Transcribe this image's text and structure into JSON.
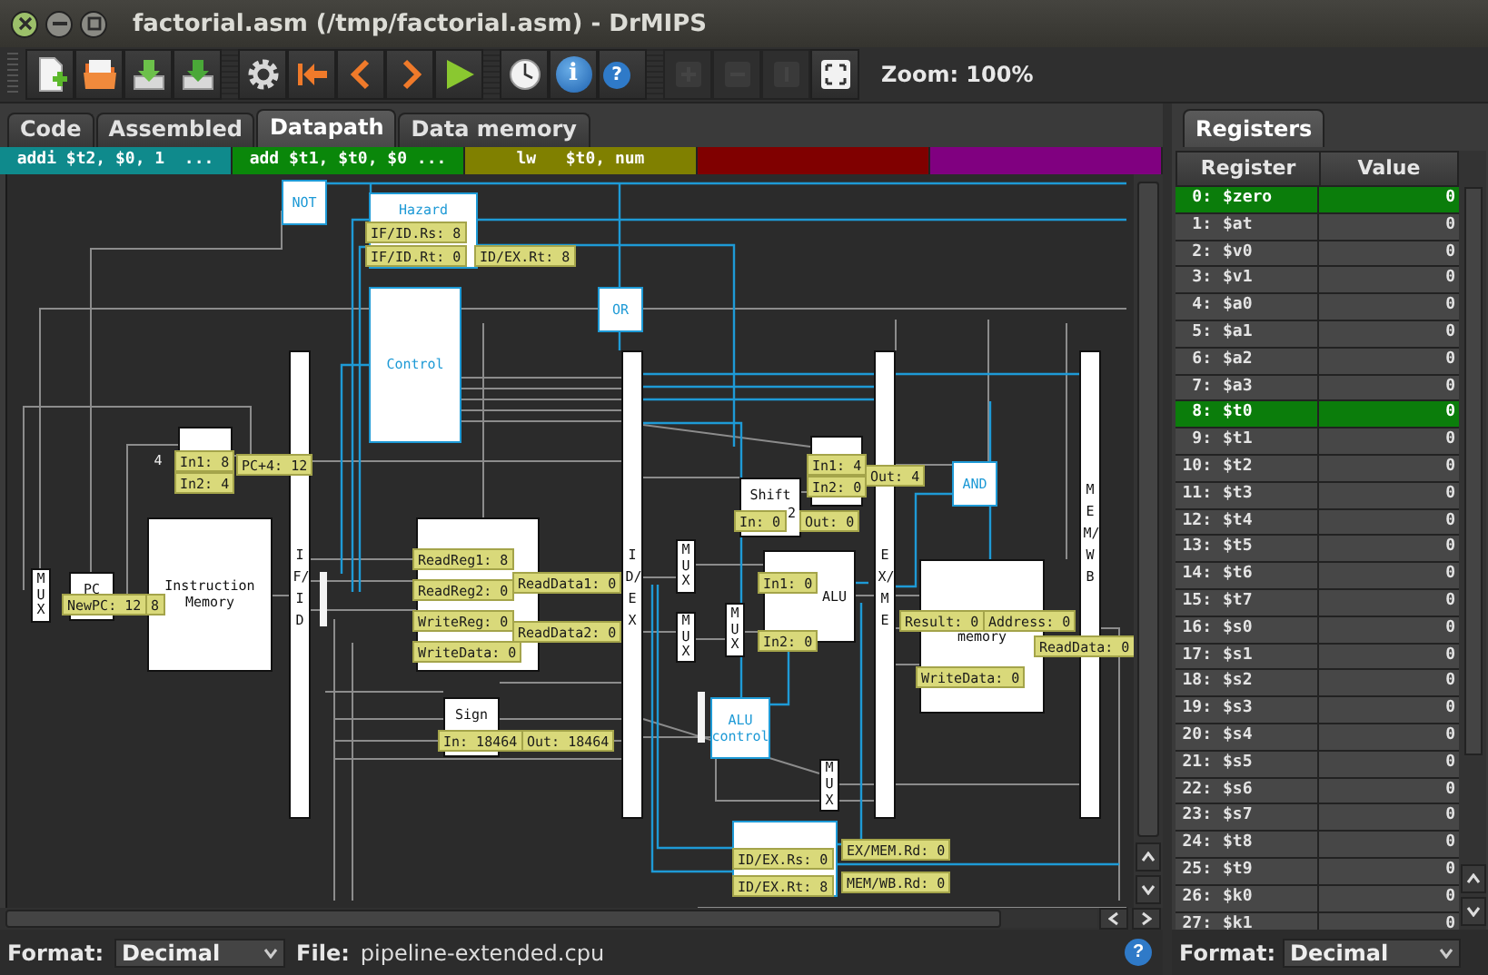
{
  "window": {
    "title": "factorial.asm (/tmp/factorial.asm) - DrMIPS"
  },
  "toolbar": [
    {
      "kind": "new",
      "disabled": false
    },
    {
      "kind": "open",
      "disabled": false
    },
    {
      "kind": "save",
      "disabled": false
    },
    {
      "kind": "save_as",
      "disabled": false
    },
    {
      "kind": "settings",
      "disabled": false
    },
    {
      "kind": "restart",
      "disabled": false
    },
    {
      "kind": "back",
      "disabled": false
    },
    {
      "kind": "forward",
      "disabled": false
    },
    {
      "kind": "run",
      "disabled": false
    },
    {
      "kind": "clock",
      "disabled": false
    },
    {
      "kind": "info",
      "glyph": "i",
      "disabled": false
    },
    {
      "kind": "help",
      "glyph": "?",
      "disabled": false
    },
    {
      "kind": "zoom_in",
      "disabled": true
    },
    {
      "kind": "zoom_out",
      "disabled": true
    },
    {
      "kind": "zoom_normal",
      "disabled": true
    },
    {
      "kind": "zoom_fit",
      "disabled": false
    }
  ],
  "zoom_label": "Zoom: 100%",
  "tabs": [
    {
      "label": "Code",
      "selected": false
    },
    {
      "label": "Assembled",
      "selected": false
    },
    {
      "label": "Datapath",
      "selected": true
    },
    {
      "label": "Data memory",
      "selected": false
    }
  ],
  "pipeline_stages": [
    {
      "instruction": "addi $t2, $0, 1  ...",
      "color": "#0f8a8c"
    },
    {
      "instruction": "add $t1, $t0, $0 ...",
      "color": "#0a870a"
    },
    {
      "instruction": "lw   $t0, num",
      "color": "#808000"
    },
    {
      "color": "#800000"
    },
    {
      "color": "#800080"
    }
  ],
  "datapath": {
    "components": [
      {
        "kind": "unit",
        "label": "NOT"
      },
      {
        "kind": "unit",
        "label": "Hazard"
      },
      {
        "kind": "unit",
        "label": "Control"
      },
      {
        "kind": "unit",
        "label": "OR"
      },
      {
        "kind": "unit",
        "label": "AND"
      },
      {
        "kind": "unit",
        "label": "ALU control"
      },
      {
        "kind": "unit"
      },
      {
        "kind": "block"
      },
      {
        "kind": "block",
        "label": "PC"
      },
      {
        "kind": "block",
        "label": "Instruction Memory"
      },
      {
        "kind": "block"
      },
      {
        "kind": "block",
        "label": "Sign"
      },
      {
        "kind": "block",
        "label": "Shift",
        "sublabel": "2"
      },
      {
        "kind": "block"
      },
      {
        "kind": "block",
        "label": "ALU"
      },
      {
        "kind": "block",
        "label": "memory"
      },
      {
        "kind": "pipeline_register",
        "label": "IF/ID"
      },
      {
        "kind": "pipeline_register",
        "label": "ID/EX"
      },
      {
        "kind": "pipeline_register",
        "label": "EX/ME"
      },
      {
        "kind": "pipeline_register",
        "label": "MEM/WB"
      },
      {
        "kind": "mux",
        "label": "MUX"
      },
      {
        "kind": "mux",
        "label": "MUX"
      },
      {
        "kind": "mux",
        "label": "MUX"
      },
      {
        "kind": "mux",
        "label": "MUX"
      },
      {
        "kind": "mux",
        "label": "MUX"
      },
      {
        "kind": "constant",
        "label": "4"
      }
    ],
    "probes": [
      "IF/ID.Rs: 8",
      "IF/ID.Rt: 0",
      "ID/EX.Rt: 8",
      "In1: 8",
      "In2: 4",
      "PC+4: 12",
      "NewPC: 12",
      "8",
      "ReadReg1: 8",
      "ReadReg2: 0",
      "WriteReg: 0",
      "WriteData: 0",
      "ReadData1: 0",
      "ReadData2: 0",
      "In1: 4",
      "In2: 0",
      "Out: 4",
      "In: 0",
      "Out: 0",
      "In1: 0",
      "In2: 0",
      "Result: 0",
      "Address: 0",
      "WriteData: 0",
      "ReadData: 0",
      "In: 18464",
      "Out: 18464",
      "ID/EX.Rs: 0",
      "ID/EX.Rt: 8",
      "EX/MEM.Rd: 0",
      "MEM/WB.Rd: 0"
    ]
  },
  "status_bar": {
    "format_label": "Format:",
    "format_value": "Decimal",
    "file_label": "File:",
    "file_value": "pipeline-extended.cpu",
    "help_glyph": "?"
  },
  "registers_panel": {
    "tab": "Registers",
    "columns": [
      "Register",
      "Value"
    ],
    "rows": [
      {
        "number": "0:",
        "name": "$zero",
        "value": "0",
        "highlighted": true
      },
      {
        "number": "1:",
        "name": "$at",
        "value": "0",
        "highlighted": false
      },
      {
        "number": "2:",
        "name": "$v0",
        "value": "0",
        "highlighted": false
      },
      {
        "number": "3:",
        "name": "$v1",
        "value": "0",
        "highlighted": false
      },
      {
        "number": "4:",
        "name": "$a0",
        "value": "0",
        "highlighted": false
      },
      {
        "number": "5:",
        "name": "$a1",
        "value": "0",
        "highlighted": false
      },
      {
        "number": "6:",
        "name": "$a2",
        "value": "0",
        "highlighted": false
      },
      {
        "number": "7:",
        "name": "$a3",
        "value": "0",
        "highlighted": false
      },
      {
        "number": "8:",
        "name": "$t0",
        "value": "0",
        "highlighted": true
      },
      {
        "number": "9:",
        "name": "$t1",
        "value": "0",
        "highlighted": false
      },
      {
        "number": "10:",
        "name": "$t2",
        "value": "0",
        "highlighted": false
      },
      {
        "number": "11:",
        "name": "$t3",
        "value": "0",
        "highlighted": false
      },
      {
        "number": "12:",
        "name": "$t4",
        "value": "0",
        "highlighted": false
      },
      {
        "number": "13:",
        "name": "$t5",
        "value": "0",
        "highlighted": false
      },
      {
        "number": "14:",
        "name": "$t6",
        "value": "0",
        "highlighted": false
      },
      {
        "number": "15:",
        "name": "$t7",
        "value": "0",
        "highlighted": false
      },
      {
        "number": "16:",
        "name": "$s0",
        "value": "0",
        "highlighted": false
      },
      {
        "number": "17:",
        "name": "$s1",
        "value": "0",
        "highlighted": false
      },
      {
        "number": "18:",
        "name": "$s2",
        "value": "0",
        "highlighted": false
      },
      {
        "number": "19:",
        "name": "$s3",
        "value": "0",
        "highlighted": false
      },
      {
        "number": "20:",
        "name": "$s4",
        "value": "0",
        "highlighted": false
      },
      {
        "number": "21:",
        "name": "$s5",
        "value": "0",
        "highlighted": false
      },
      {
        "number": "22:",
        "name": "$s6",
        "value": "0",
        "highlighted": false
      },
      {
        "number": "23:",
        "name": "$s7",
        "value": "0",
        "highlighted": false
      },
      {
        "number": "24:",
        "name": "$t8",
        "value": "0",
        "highlighted": false
      },
      {
        "number": "25:",
        "name": "$t9",
        "value": "0",
        "highlighted": false
      },
      {
        "number": "26:",
        "name": "$k0",
        "value": "0",
        "highlighted": false
      },
      {
        "number": "27:",
        "name": "$k1",
        "value": "0",
        "highlighted": false
      }
    ],
    "format_label": "Format:",
    "format_value": "Decimal"
  }
}
